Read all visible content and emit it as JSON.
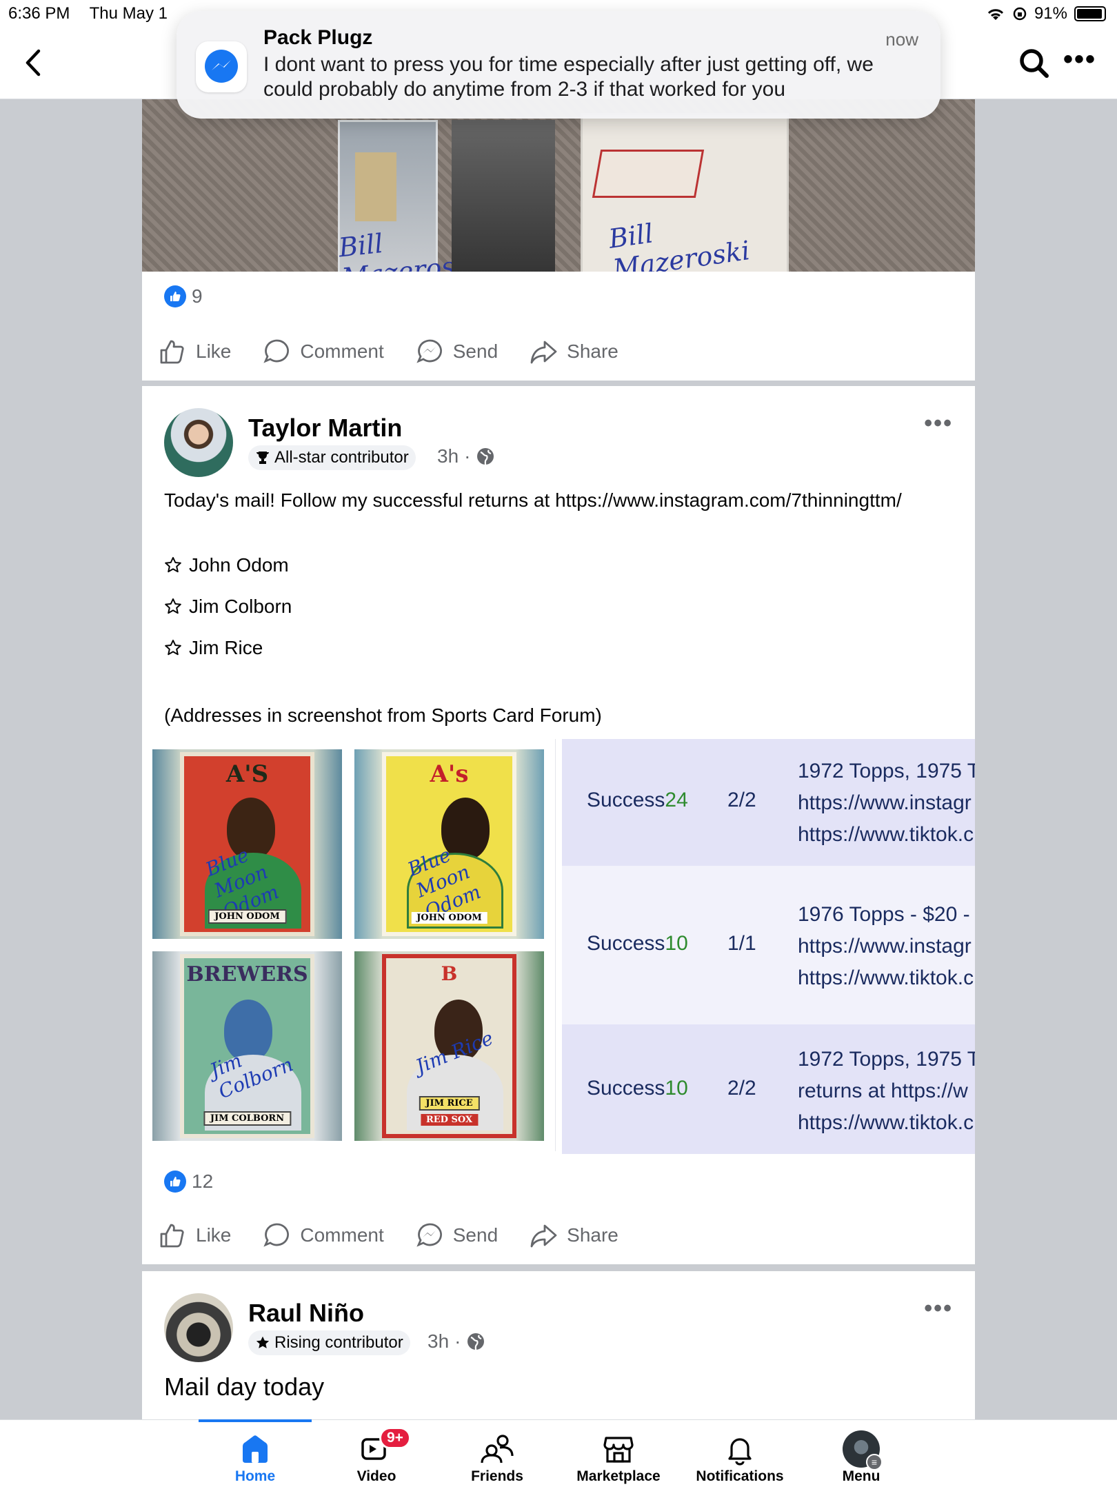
{
  "status_bar": {
    "time": "6:36 PM",
    "date": "Thu May 1",
    "battery": "91%"
  },
  "notification": {
    "app_icon": "messenger-icon",
    "title": "Pack Plugz",
    "time": "now",
    "body": "I dont want to press you for time especially after just getting off, we could probably do anytime from 2-3 if that worked for you"
  },
  "post1": {
    "photo_signatures": [
      "Bill Mazeroski",
      "Bill Mazeroski"
    ],
    "reaction_count": "9",
    "actions": {
      "like": "Like",
      "comment": "Comment",
      "send": "Send",
      "share": "Share"
    }
  },
  "post2": {
    "author": "Taylor Martin",
    "badge": "All-star contributor",
    "time": "3h",
    "intro": "Today's mail! Follow my successful returns at https://www.instagram.com/7thinningttm/",
    "items": [
      "John Odom",
      "Jim Colborn",
      "Jim Rice"
    ],
    "footer": "(Addresses in screenshot from Sports Card Forum)",
    "cards": [
      {
        "team": "A'S",
        "name": "JOHN ODOM",
        "autograph": "Blue Moon Odom"
      },
      {
        "team": "A's",
        "name": "JOHN ODOM",
        "autograph": "Blue Moon Odom"
      },
      {
        "team": "BREWERS",
        "name": "JIM COLBORN",
        "autograph": "Jim Colborn"
      },
      {
        "team": "B",
        "name": "JIM RICE",
        "autograph": "Jim Rice",
        "subtitle": "RED SOX"
      }
    ],
    "table_rows": [
      {
        "label": "Success",
        "num": "24",
        "ratio": "2/2",
        "lines": [
          "1972 Topps, 1975 T",
          "https://www.instagr",
          "https://www.tiktok.c"
        ]
      },
      {
        "label": "Success",
        "num": "10",
        "ratio": "1/1",
        "lines": [
          "1976 Topps - $20 -",
          "https://www.instagr",
          "https://www.tiktok.c"
        ]
      },
      {
        "label": "Success",
        "num": "10",
        "ratio": "2/2",
        "lines": [
          "1972 Topps, 1975 T",
          "returns at https://w",
          "https://www.tiktok.c"
        ]
      }
    ],
    "reaction_count": "12",
    "actions": {
      "like": "Like",
      "comment": "Comment",
      "send": "Send",
      "share": "Share"
    }
  },
  "post3": {
    "author": "Raul Niño",
    "badge": "Rising contributor",
    "time": "3h",
    "text": "Mail day today"
  },
  "bottom_nav": {
    "items": [
      {
        "label": "Home",
        "icon": "home-icon"
      },
      {
        "label": "Video",
        "icon": "video-icon",
        "badge": "9+"
      },
      {
        "label": "Friends",
        "icon": "friends-icon"
      },
      {
        "label": "Marketplace",
        "icon": "marketplace-icon"
      },
      {
        "label": "Notifications",
        "icon": "bell-icon"
      },
      {
        "label": "Menu",
        "icon": "profile-avatar"
      }
    ]
  },
  "colors": {
    "accent": "#1877f2",
    "badge_red": "#e41e3f",
    "feed_bg": "#c9ccd1"
  }
}
